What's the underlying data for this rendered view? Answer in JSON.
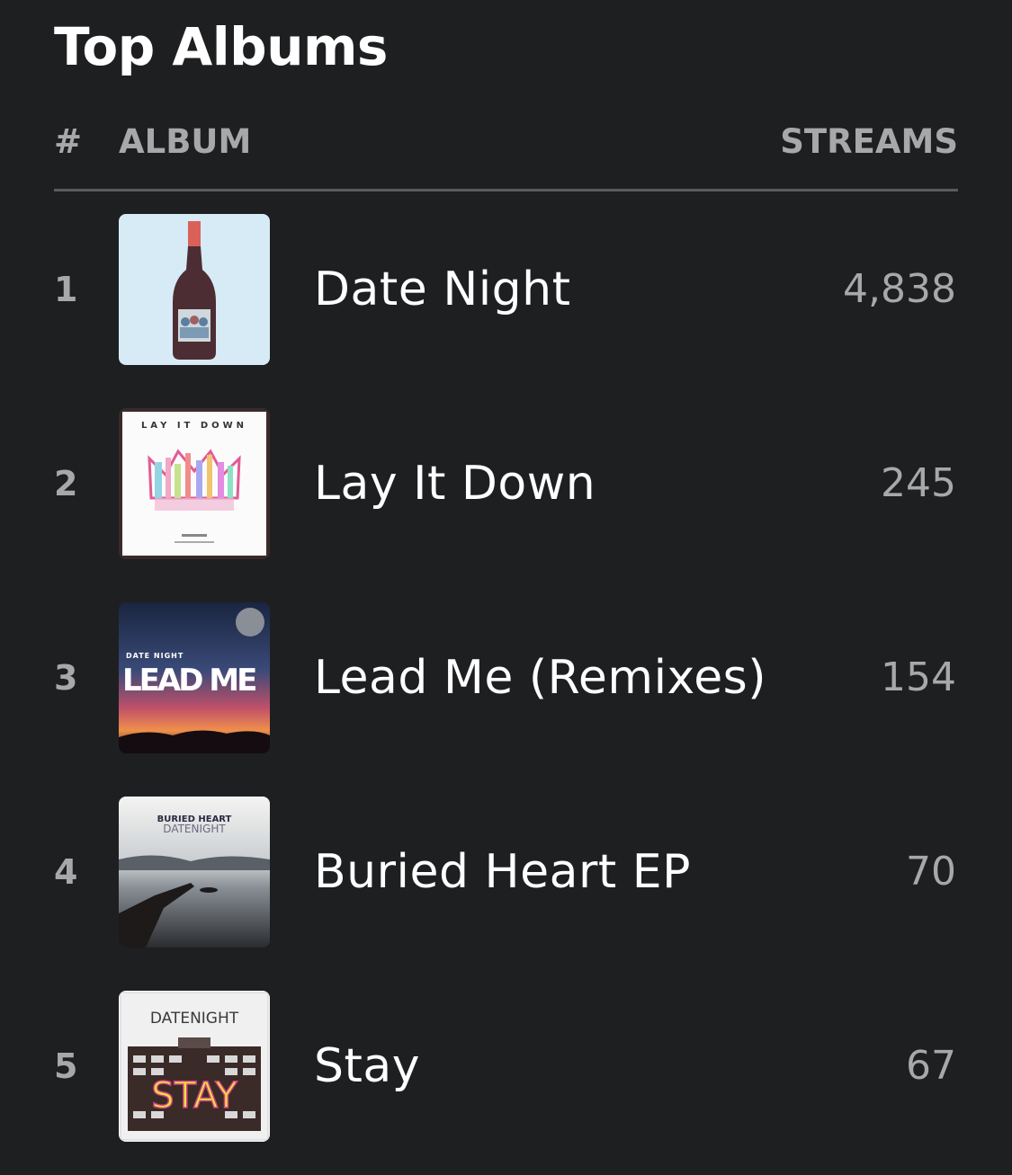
{
  "section": {
    "title": "Top Albums"
  },
  "table": {
    "rank_header": "#",
    "album_header": "ALBUM",
    "streams_header": "STREAMS"
  },
  "albums": [
    {
      "rank": "1",
      "title": "Date Night",
      "streams": "4,838",
      "cover_icon": "wine-bottle-cover"
    },
    {
      "rank": "2",
      "title": "Lay It Down",
      "streams": "245",
      "cover_icon": "crown-cover",
      "cover_text": "LAY IT DOWN"
    },
    {
      "rank": "3",
      "title": "Lead Me (Remixes)",
      "streams": "154",
      "cover_icon": "sunset-cover",
      "cover_text": "LEAD ME",
      "cover_small_text": "DATE NIGHT"
    },
    {
      "rank": "4",
      "title": "Buried Heart EP",
      "streams": "70",
      "cover_icon": "pier-cover",
      "cover_text": "BURIED HEART",
      "cover_small_text": "DATENIGHT"
    },
    {
      "rank": "5",
      "title": "Stay",
      "streams": "67",
      "cover_icon": "building-cover",
      "cover_text": "STAY",
      "cover_small_text": "DATENIGHT"
    }
  ],
  "colors": {
    "background": "#1e1f21",
    "primary_text": "#ffffff",
    "secondary_text": "#a7a8aa",
    "divider": "#5a5b5e"
  }
}
